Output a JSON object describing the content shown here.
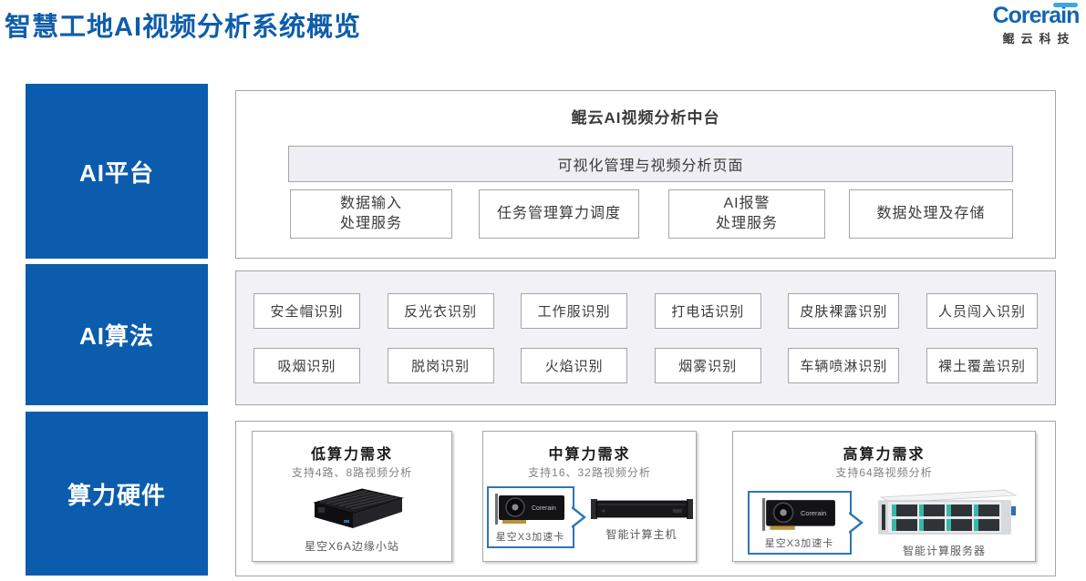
{
  "header": {
    "title": "智慧工地AI视频分析系统概览",
    "logo": {
      "brand": "Corerain",
      "company": "鲲云科技"
    }
  },
  "sidebar": {
    "items": [
      {
        "label": "AI平台"
      },
      {
        "label": "AI算法"
      },
      {
        "label": "算力硬件"
      }
    ]
  },
  "ai_platform": {
    "title": "鲲云AI视频分析中台",
    "banner": "可视化管理与视频分析页面",
    "boxes": [
      {
        "lines": [
          "数据输入",
          "处理服务"
        ]
      },
      {
        "lines": [
          "任务管理算力调度"
        ]
      },
      {
        "lines": [
          "AI报警",
          "处理服务"
        ]
      },
      {
        "lines": [
          "数据处理及存储"
        ]
      }
    ]
  },
  "ai_algorithms": {
    "items": [
      "安全帽识别",
      "反光衣识别",
      "工作服识别",
      "打电话识别",
      "皮肤裸露识别",
      "人员闯入识别",
      "吸烟识别",
      "脱岗识别",
      "火焰识别",
      "烟雾识别",
      "车辆喷淋识别",
      "裸土覆盖识别"
    ]
  },
  "hardware": {
    "cards": [
      {
        "title": "低算力需求",
        "subtitle": "支持4路、8路视频分析",
        "device": {
          "label": "星空X6A边缘小站"
        }
      },
      {
        "title": "中算力需求",
        "subtitle": "支持16、32路视频分析",
        "accelerator": {
          "label": "星空X3加速卡"
        },
        "host": {
          "label": "智能计算主机"
        }
      },
      {
        "title": "高算力需求",
        "subtitle": "支持64路视频分析",
        "accelerator": {
          "label": "星空X3加速卡"
        },
        "host": {
          "label": "智能计算服务器"
        }
      }
    ],
    "gpu_chip_text": "Corerain"
  },
  "colors": {
    "primary_blue": "#0b5cad",
    "title_blue": "#0f5dab",
    "logo_accent": "#3aa8dc",
    "callout_border": "#2e75b6",
    "panel_border": "#a6a6a6",
    "banner_bg": "#eeeef4",
    "algo_panel_bg": "#f2f2f6"
  }
}
